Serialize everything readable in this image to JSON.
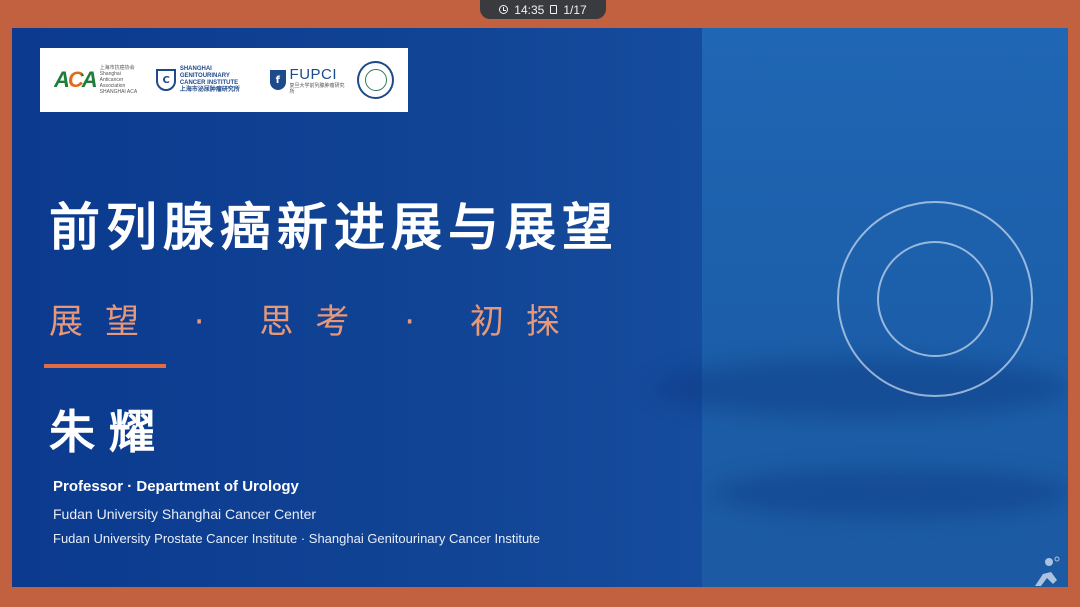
{
  "toolbar": {
    "time": "14:35",
    "page": "1/17"
  },
  "slide": {
    "logos": {
      "aca_mark": "ACA",
      "aca_lines": [
        "上海市抗癌协会",
        "Shanghai",
        "Anticancer Association",
        "SHANGHAI ACA"
      ],
      "sgci_lines": [
        "SHANGHAI GENITOURINARY",
        "CANCER INSTITUTE",
        "上海市泌尿肿瘤研究所"
      ],
      "fupci_mark": "FUPCI",
      "fupci_sub": "复旦大学前列腺肿瘤研究所"
    },
    "title": "前列腺癌新进展与展望",
    "subtitle": "展望 · 思考 · 初探",
    "presenter": "朱耀",
    "role": "Professor · Department of Urology",
    "affiliation1": "Fudan University Shanghai Cancer Center",
    "affiliation2": "Fudan University Prostate Cancer Institute · Shanghai Genitourinary Cancer Institute"
  },
  "colors": {
    "frame": "#c2613f",
    "slide_blue": "#124596",
    "accent": "#e06b45",
    "subtitle": "#e79878"
  }
}
